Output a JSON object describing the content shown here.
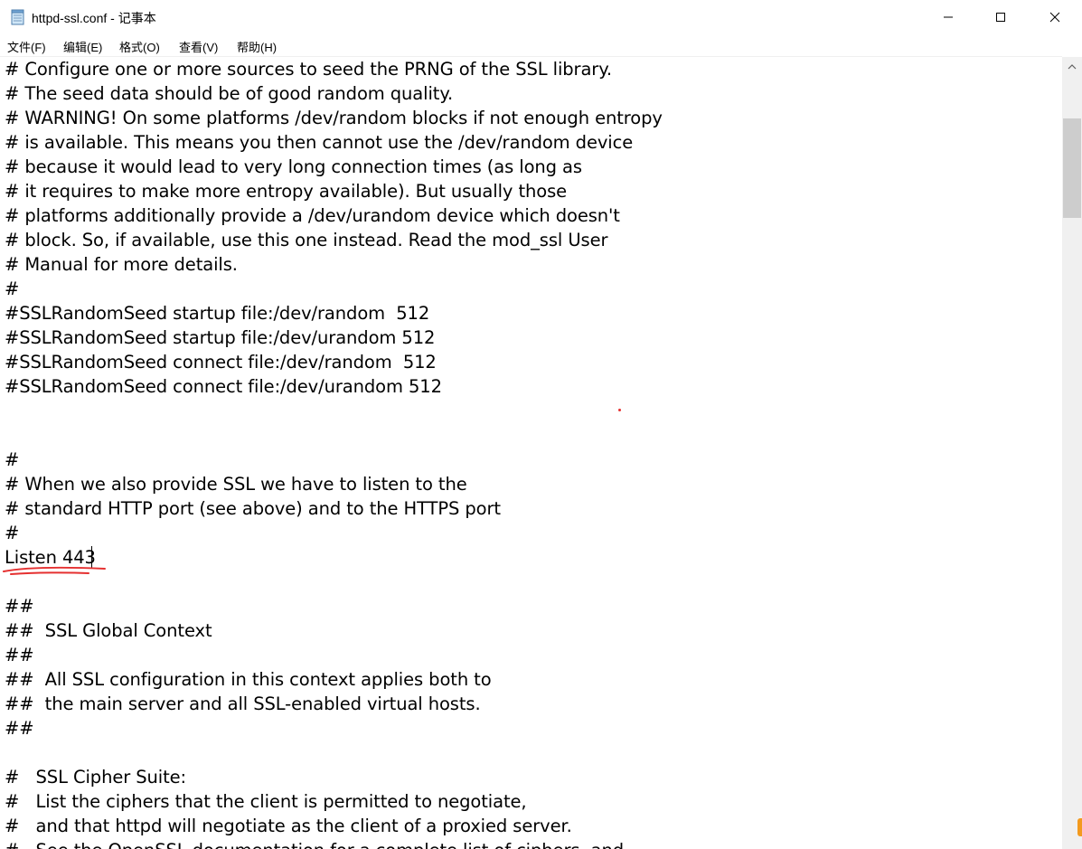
{
  "window": {
    "title": "httpd-ssl.conf - 记事本",
    "icon": "notepad-icon",
    "controls": [
      "minimize-icon",
      "maximize-icon",
      "close-icon"
    ]
  },
  "menu": {
    "file": "文件(F)",
    "edit": "编辑(E)",
    "format": "格式(O)",
    "view": "查看(V)",
    "help": "帮助(H)"
  },
  "editor": {
    "lines": [
      "# Configure one or more sources to seed the PRNG of the SSL library.",
      "# The seed data should be of good random quality.",
      "# WARNING! On some platforms /dev/random blocks if not enough entropy",
      "# is available. This means you then cannot use the /dev/random device",
      "# because it would lead to very long connection times (as long as",
      "# it requires to make more entropy available). But usually those",
      "# platforms additionally provide a /dev/urandom device which doesn't",
      "# block. So, if available, use this one instead. Read the mod_ssl User",
      "# Manual for more details.",
      "#",
      "#SSLRandomSeed startup file:/dev/random  512",
      "#SSLRandomSeed startup file:/dev/urandom 512",
      "#SSLRandomSeed connect file:/dev/random  512",
      "#SSLRandomSeed connect file:/dev/urandom 512",
      "",
      "",
      "#",
      "# When we also provide SSL we have to listen to the",
      "# standard HTTP port (see above) and to the HTTPS port",
      "#",
      "Listen 443",
      "",
      "##",
      "##  SSL Global Context",
      "##",
      "##  All SSL configuration in this context applies both to",
      "##  the main server and all SSL-enabled virtual hosts.",
      "##",
      "",
      "#   SSL Cipher Suite:",
      "#   List the ciphers that the client is permitted to negotiate,",
      "#   and that httpd will negotiate as the client of a proxied server.",
      "#   See the OpenSSL documentation for a complete list of ciphers, and"
    ]
  },
  "colors": {
    "annotation": "#e53030",
    "scroll_thumb": "#cdcdcd",
    "scroll_track": "#f0f0f0"
  }
}
